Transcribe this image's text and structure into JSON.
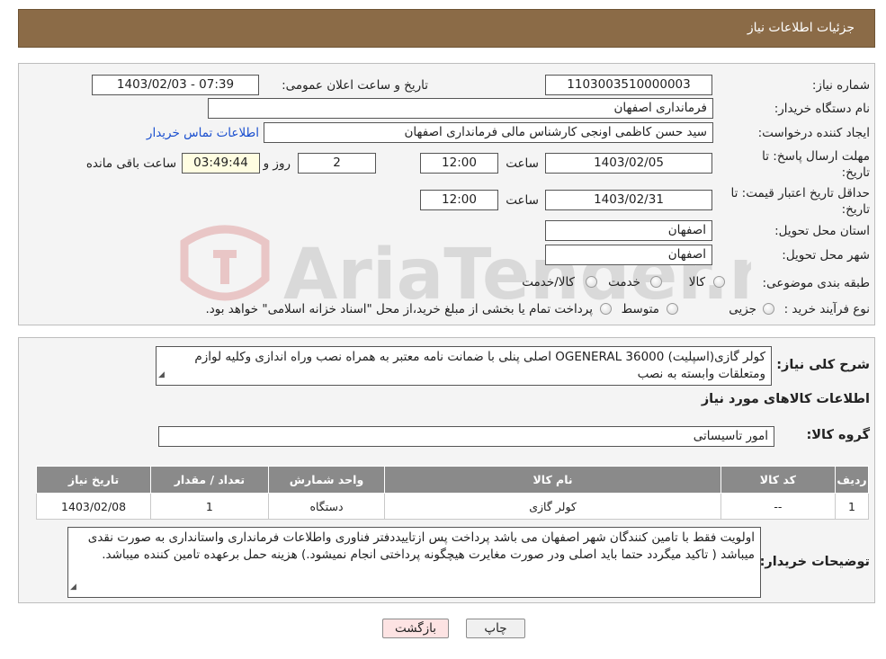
{
  "header": {
    "title": "جزئیات اطلاعات نیاز"
  },
  "form": {
    "need_number_label": "شماره نیاز:",
    "need_number": "1103003510000003",
    "announce_label": "تاریخ و ساعت اعلان عمومی:",
    "announce_value": "1403/02/03 - 07:39",
    "buyer_org_label": "نام دستگاه خریدار:",
    "buyer_org": "فرمانداری اصفهان",
    "creator_label": "ایجاد کننده درخواست:",
    "creator": "سید حسن  کاظمی اونجی کارشناس مالی  فرمانداری اصفهان",
    "contact_link": "اطلاعات تماس خریدار",
    "deadline_label_1": "مهلت ارسال پاسخ: تا",
    "deadline_label_2": "تاریخ:",
    "deadline_date": "1403/02/05",
    "time_label": "ساعت",
    "deadline_time": "12:00",
    "days_value": "2",
    "days_label": "روز و",
    "remaining_time": "03:49:44",
    "remaining_label": "ساعت باقی مانده",
    "validity_label_1": "حداقل تاریخ اعتبار قیمت: تا",
    "validity_label_2": "تاریخ:",
    "validity_date": "1403/02/31",
    "validity_time_label": "ساعت",
    "validity_time": "12:00",
    "province_label": "استان محل تحویل:",
    "province": "اصفهان",
    "city_label": "شهر محل تحویل:",
    "city": "اصفهان",
    "category_label": "طبقه بندی موضوعی:",
    "category_options": [
      "کالا",
      "خدمت",
      "کالا/خدمت"
    ],
    "process_label": "نوع فرآیند خرید :",
    "process_options": [
      "جزیی",
      "متوسط"
    ],
    "process_note": "پرداخت تمام یا بخشی از مبلغ خرید،از محل \"اسناد خزانه اسلامی\" خواهد بود."
  },
  "details": {
    "description_label": "شرح کلی نیاز:",
    "description": "کولر گازی(اسپلیت) OGENERAL 36000 اصلی پنلی  با ضمانت نامه معتبر به همراه نصب وراه اندازی وکلیه لوازم ومتعلقات وابسته به نصب",
    "goods_info_title": "اطلاعات کالاهای مورد نیاز",
    "goods_group_label": "گروه کالا:",
    "goods_group": "امور تاسیساتی",
    "table": {
      "headers": [
        "ردیف",
        "کد کالا",
        "نام کالا",
        "واحد شمارش",
        "تعداد / مقدار",
        "تاریخ نیاز"
      ],
      "rows": [
        [
          "1",
          "--",
          "کولر گازی",
          "دستگاه",
          "1",
          "1403/02/08"
        ]
      ]
    },
    "buyer_notes_label": "توضیحات خریدار:",
    "buyer_notes": "اولویت فقط با تامین کنندگان شهر اصفهان می باشد پرداخت پس ازتاییددفتر فناوری واطلاعات فرمانداری واستانداری  به صورت نقدی میباشد ( تاکید میگردد حتما باید اصلی ودر صورت مغایرت هیچگونه پرداختی  انجام  نمیشود.) هزینه حمل برعهده تامین کننده میباشد."
  },
  "buttons": {
    "print": "چاپ",
    "back": "بازگشت"
  },
  "watermark": {
    "text": "AriaTender.neT"
  },
  "colors": {
    "header_bg": "#8b6b47",
    "table_header_bg": "#8a8a8a",
    "back_button_bg": "#fde3e3",
    "link": "#1a4fcf"
  }
}
